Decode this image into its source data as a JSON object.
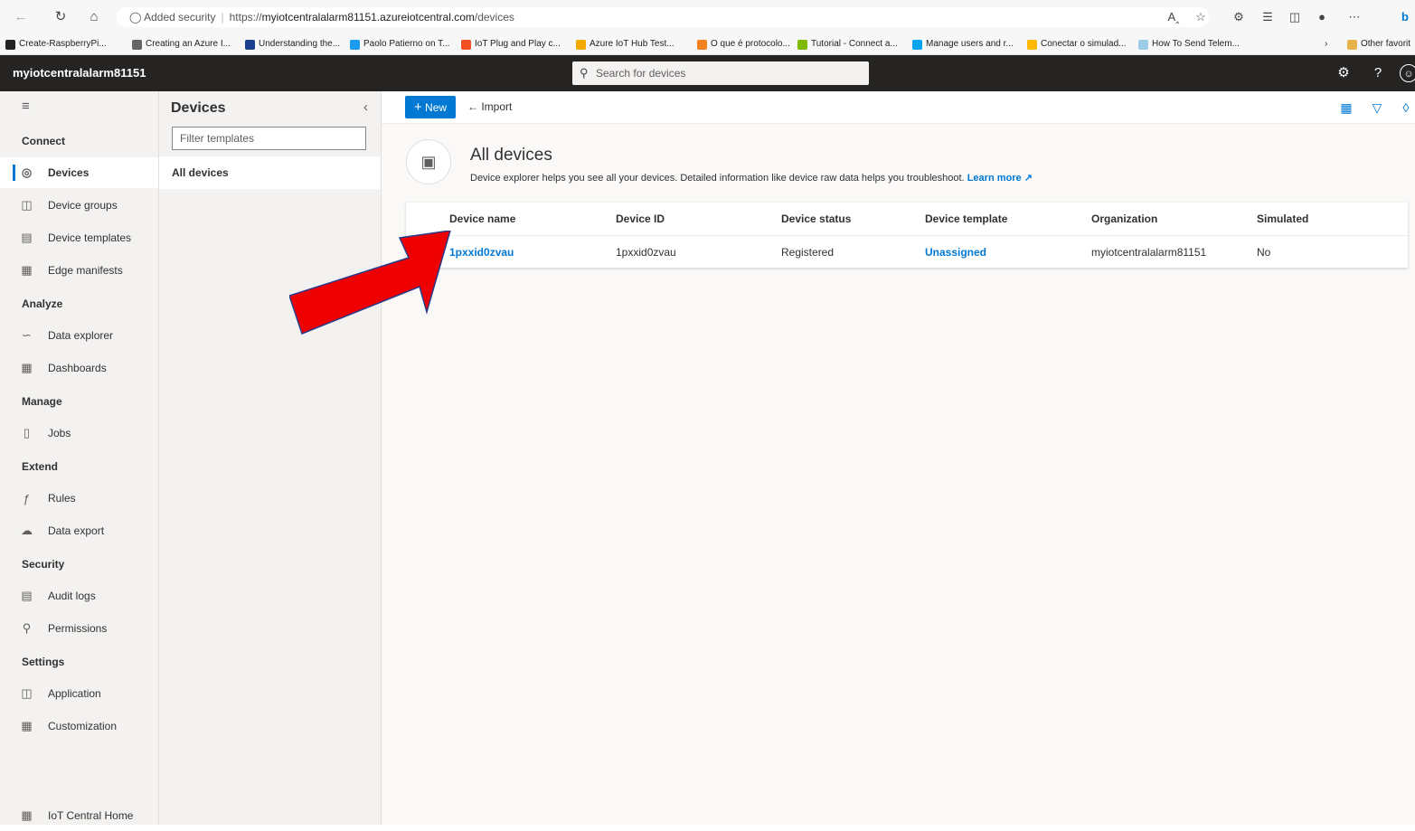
{
  "browser": {
    "security_label": "Added security",
    "url_prefix": "https://",
    "url_host": "myiotcentralalarm81151.azureiotcentral.com",
    "url_path": "/devices",
    "bookmarks": [
      {
        "label": "Create-RaspberryPi...",
        "color": "#222222"
      },
      {
        "label": "Creating an Azure I...",
        "color": "#666666"
      },
      {
        "label": "Understanding the...",
        "color": "#1b3f8f"
      },
      {
        "label": "Paolo Patierno on T...",
        "color": "#1d9bf0"
      },
      {
        "label": "IoT Plug and Play c...",
        "color": "#f25022"
      },
      {
        "label": "Azure IoT Hub Test...",
        "color": "#f2a900"
      },
      {
        "label": "O que é protocolo...",
        "color": "#f48120"
      },
      {
        "label": "Tutorial - Connect a...",
        "color": "#7fba00"
      },
      {
        "label": "Manage users and r...",
        "color": "#00a4ef"
      },
      {
        "label": "Conectar o simulad...",
        "color": "#ffb900"
      },
      {
        "label": "How To Send Telem...",
        "color": "#9ccbe8"
      }
    ],
    "other_favorites": "Other favorit"
  },
  "app": {
    "title": "myiotcentralalarm81151",
    "search_placeholder": "Search for devices"
  },
  "nav": {
    "sections": {
      "connect": "Connect",
      "analyze": "Analyze",
      "manage": "Manage",
      "extend": "Extend",
      "security": "Security",
      "settings": "Settings"
    },
    "items": {
      "devices": "Devices",
      "device_groups": "Device groups",
      "device_templates": "Device templates",
      "edge_manifests": "Edge manifests",
      "data_explorer": "Data explorer",
      "dashboards": "Dashboards",
      "jobs": "Jobs",
      "rules": "Rules",
      "data_export": "Data export",
      "audit_logs": "Audit logs",
      "permissions": "Permissions",
      "application": "Application",
      "customization": "Customization",
      "iot_central_home": "IoT Central Home"
    }
  },
  "sub_panel": {
    "title": "Devices",
    "filter_placeholder": "Filter templates",
    "all_devices": "All devices"
  },
  "command_bar": {
    "new_label": "New",
    "import_label": "Import"
  },
  "main": {
    "title": "All devices",
    "description": "Device explorer helps you see all your devices. Detailed information like device raw data helps you troubleshoot.",
    "learn_more": "Learn more",
    "table": {
      "headers": {
        "device_name": "Device name",
        "device_id": "Device ID",
        "device_status": "Device status",
        "device_template": "Device template",
        "organization": "Organization",
        "simulated": "Simulated"
      },
      "rows": [
        {
          "device_name": "1pxxid0zvau",
          "device_id": "1pxxid0zvau",
          "device_status": "Registered",
          "device_template": "Unassigned",
          "organization": "myiotcentralalarm81151",
          "simulated": "No"
        }
      ]
    }
  },
  "colors": {
    "accent": "#0078d4",
    "header_bg": "#252423",
    "arrow_fill": "#ee0000",
    "arrow_stroke": "#2b3a8c"
  }
}
